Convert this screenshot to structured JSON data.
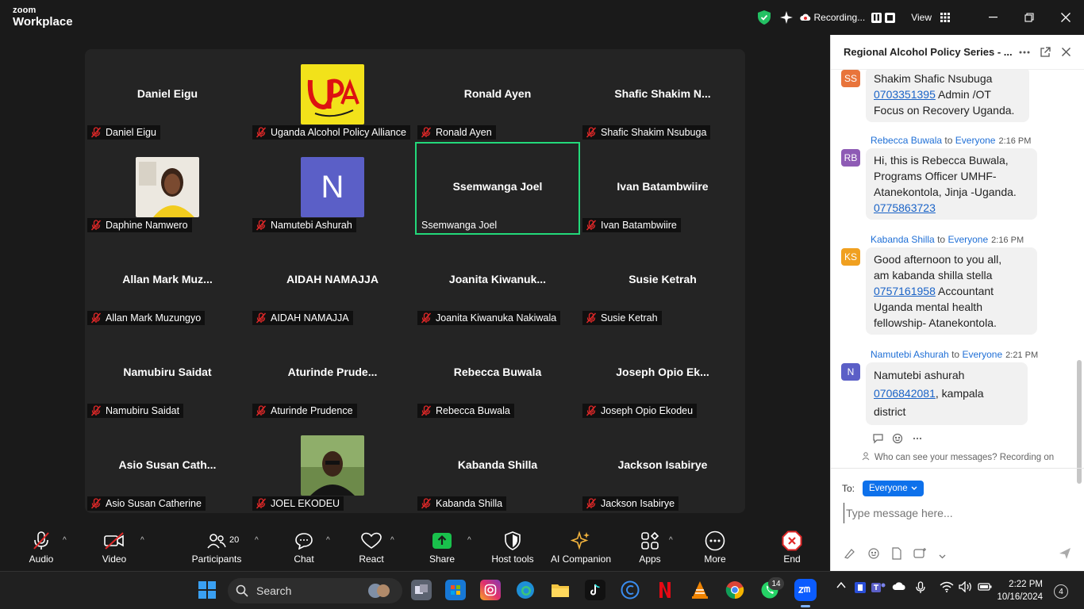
{
  "app": {
    "brand_line1": "zoom",
    "brand_line2": "Workplace",
    "recording_label": "Recording...",
    "view_label": "View"
  },
  "tiles": [
    {
      "center": "Daniel Eigu",
      "label": "Daniel Eigu"
    },
    {
      "center": "",
      "label": "Uganda Alcohol Policy Alliance",
      "image": "upa-logo"
    },
    {
      "center": "Ronald Ayen",
      "label": "Ronald Ayen"
    },
    {
      "center": "Shafic  Shakim  N...",
      "label": "Shafic Shakim Nsubuga"
    },
    {
      "center": "",
      "label": "Daphine Namwero",
      "image": "photo-woman"
    },
    {
      "center": "",
      "label": "Namutebi Ashurah",
      "image": "letter-avatar",
      "letter": "N"
    },
    {
      "center": "Ssemwanga Joel",
      "label": "Ssemwanga Joel",
      "active": true
    },
    {
      "center": "Ivan Batambwiire",
      "label": "Ivan Batambwiire"
    },
    {
      "center": "Allan  Mark  Muz...",
      "label": "Allan Mark Muzungyo"
    },
    {
      "center": "AIDAH NAMAJJA",
      "label": "AIDAH NAMAJJA"
    },
    {
      "center": "Joanita  Kiwanuk...",
      "label": "Joanita Kiwanuka Nakiwala"
    },
    {
      "center": "Susie Ketrah",
      "label": "Susie Ketrah"
    },
    {
      "center": "Namubiru Saidat",
      "label": "Namubiru Saidat"
    },
    {
      "center": "Aturinde  Prude...",
      "label": "Aturinde Prudence"
    },
    {
      "center": "Rebecca Buwala",
      "label": "Rebecca Buwala"
    },
    {
      "center": "Joseph  Opio  Ek...",
      "label": "Joseph Opio Ekodeu"
    },
    {
      "center": "Asio  Susan  Cath...",
      "label": "Asio Susan Catherine"
    },
    {
      "center": "",
      "label": "JOEL EKODEU",
      "image": "photo-man"
    },
    {
      "center": "Kabanda Shilla",
      "label": "Kabanda Shilla"
    },
    {
      "center": "Jackson Isabirye",
      "label": "Jackson Isabirye"
    }
  ],
  "chat": {
    "title": "Regional Alcohol Policy Series - ...",
    "messages": [
      {
        "initials": "SS",
        "color": "#e8743b",
        "lines": [
          "Shakim Shafic Nsubuga"
        ],
        "phone": "0703351395",
        "after": " Admin /OT",
        "tail": [
          "Focus on Recovery Uganda."
        ]
      },
      {
        "initials": "RB",
        "color": "#8e5bb5",
        "sender": "Rebecca Buwala",
        "to": "to",
        "recipient": "Everyone",
        "time": "2:16 PM",
        "lines": [
          "Hi, this is Rebecca Buwala,",
          "Programs Officer UMHF-",
          "Atanekontola, Jinja -Uganda."
        ],
        "phone": "0775863723"
      },
      {
        "initials": "KS",
        "color": "#f0a020",
        "sender": "Kabanda Shilla",
        "to": "to",
        "recipient": "Everyone",
        "time": "2:16 PM",
        "lines": [
          "Good afternoon to you all,",
          "am kabanda shilla stella"
        ],
        "phone": "0757161958",
        "after": " Accountant",
        "tail": [
          "Uganda mental health",
          "fellowship- Atanekontola."
        ]
      },
      {
        "initials": "N",
        "color": "#5b5fc7",
        "sender": "Namutebi Ashurah",
        "to": "to",
        "recipient": "Everyone",
        "time": "2:21 PM",
        "lines": [
          "Namutebi ashurah"
        ],
        "phone": "0706842081",
        "after": ",  kampala",
        "tail": [
          "district"
        ]
      }
    ],
    "who_can_see": "Who can see your messages? Recording on",
    "to_label": "To:",
    "to_value": "Everyone",
    "input_placeholder": "Type message here..."
  },
  "toolbar": {
    "audio": "Audio",
    "video": "Video",
    "participants": "Participants",
    "participants_count": "20",
    "chat": "Chat",
    "react": "React",
    "share": "Share",
    "host_tools": "Host tools",
    "ai_companion": "AI Companion",
    "apps": "Apps",
    "more": "More",
    "end": "End"
  },
  "taskbar": {
    "search": "Search",
    "whatsapp_badge": "14",
    "time": "2:22 PM",
    "date": "10/16/2024",
    "notifications": "4"
  }
}
